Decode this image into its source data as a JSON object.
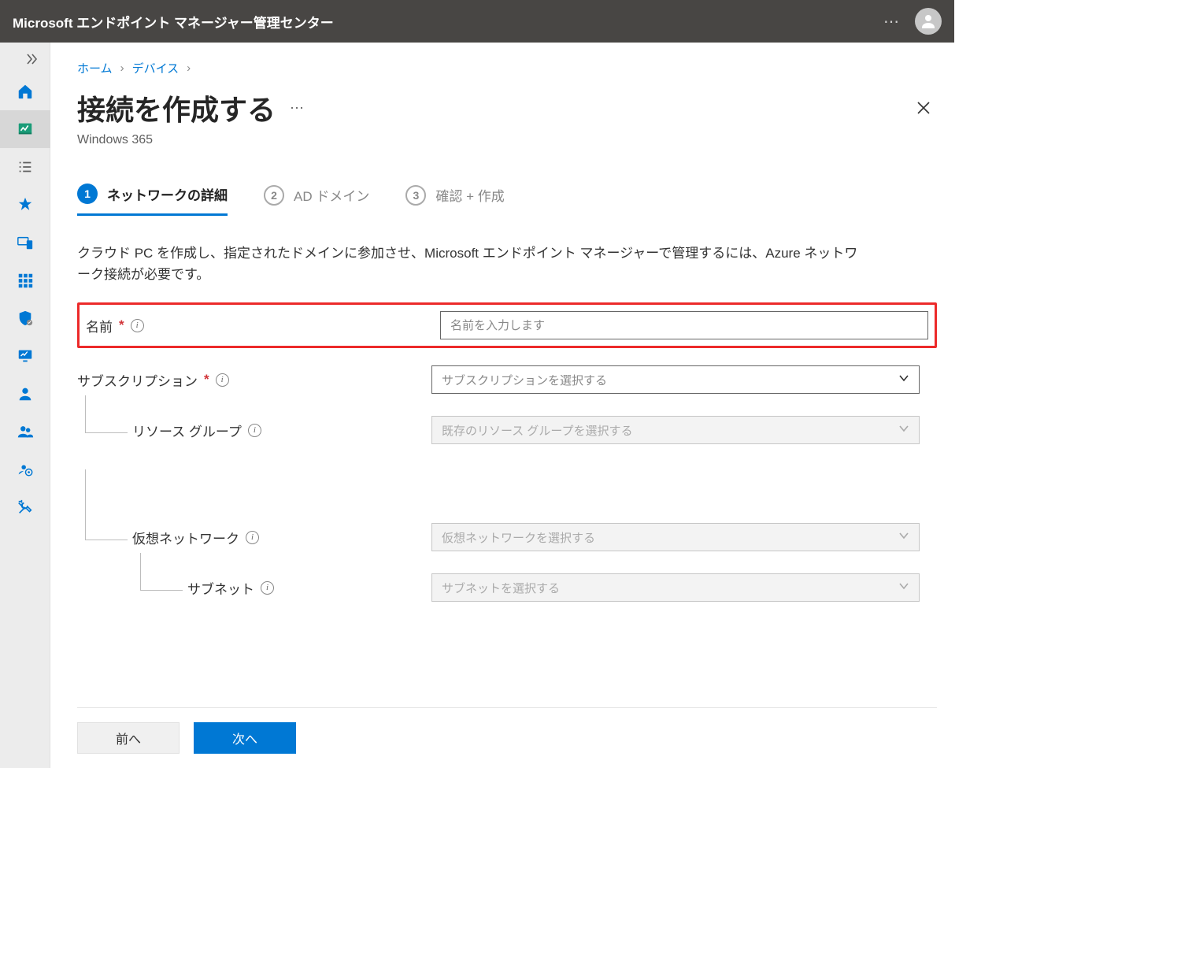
{
  "topbar": {
    "title": "Microsoft エンドポイント マネージャー管理センター"
  },
  "breadcrumb": {
    "home": "ホーム",
    "devices": "デバイス"
  },
  "page": {
    "title": "接続を作成する",
    "subtitle": "Windows 365"
  },
  "steps": {
    "s1": {
      "num": "1",
      "label": "ネットワークの詳細"
    },
    "s2": {
      "num": "2",
      "label": "AD ドメイン"
    },
    "s3": {
      "num": "3",
      "label": "確認 + 作成"
    }
  },
  "desc": "クラウド PC を作成し、指定されたドメインに参加させ、Microsoft エンドポイント マネージャーで管理するには、Azure ネットワーク接続が必要です。",
  "form": {
    "name_label": "名前",
    "name_placeholder": "名前を入力します",
    "sub_label": "サブスクリプション",
    "sub_placeholder": "サブスクリプションを選択する",
    "rg_label": "リソース グループ",
    "rg_placeholder": "既存のリソース グループを選択する",
    "vnet_label": "仮想ネットワーク",
    "vnet_placeholder": "仮想ネットワークを選択する",
    "subnet_label": "サブネット",
    "subnet_placeholder": "サブネットを選択する"
  },
  "footer": {
    "prev": "前へ",
    "next": "次へ"
  }
}
